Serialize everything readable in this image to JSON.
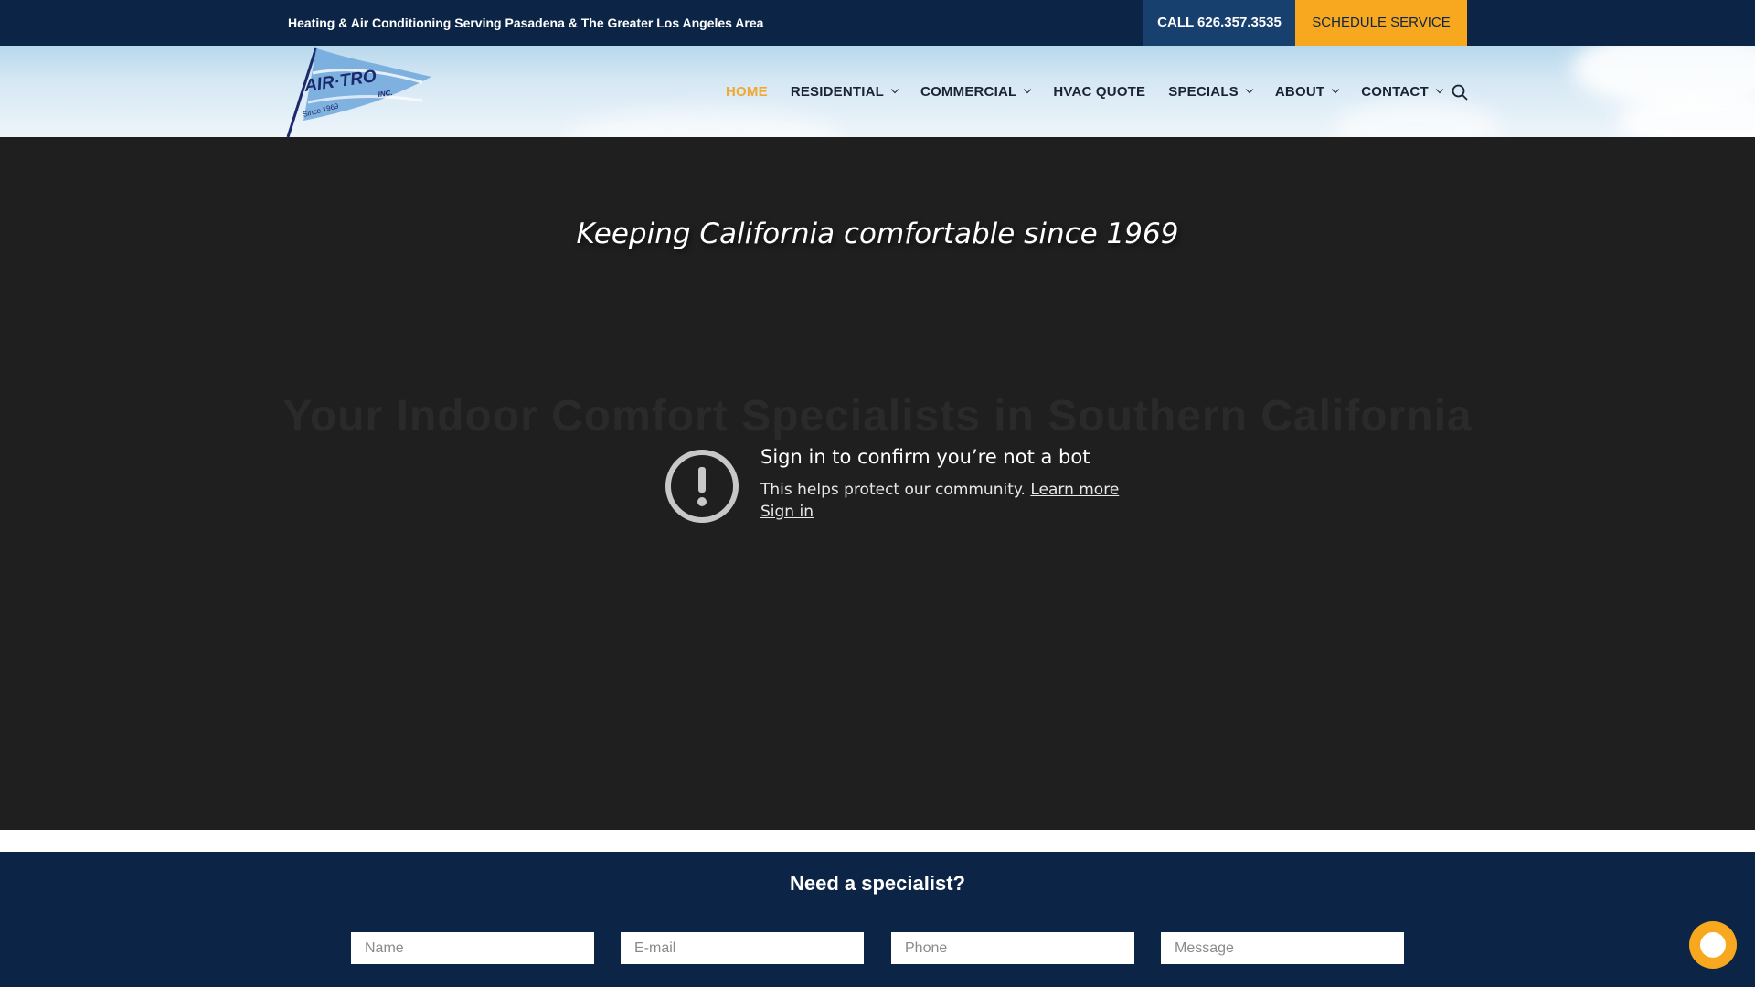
{
  "topbar": {
    "tagline": "Heating & Air Conditioning Serving Pasadena & The Greater Los Angeles Area",
    "call_label": "CALL 626.357.3535",
    "schedule_label": "SCHEDULE SERVICE"
  },
  "logo": {
    "text": "AIR·TRO",
    "suffix": "INC.",
    "since": "Since 1969"
  },
  "nav": {
    "items": [
      {
        "label": "HOME",
        "active": true,
        "dropdown": false
      },
      {
        "label": "RESIDENTIAL",
        "active": false,
        "dropdown": true
      },
      {
        "label": "COMMERCIAL",
        "active": false,
        "dropdown": true
      },
      {
        "label": "HVAC QUOTE",
        "active": false,
        "dropdown": false
      },
      {
        "label": "SPECIALS",
        "active": false,
        "dropdown": true
      },
      {
        "label": "ABOUT",
        "active": false,
        "dropdown": true
      },
      {
        "label": "CONTACT",
        "active": false,
        "dropdown": true
      }
    ],
    "search_icon": "search-icon"
  },
  "video": {
    "hero_title": "Keeping California comfortable since 1969",
    "ghost_text": "Your Indoor Comfort Specialists in Southern California",
    "bot_title": "Sign in to confirm you’re not a bot",
    "bot_sub": "This helps protect our community.",
    "learn_more": "Learn more",
    "sign_in": "Sign in"
  },
  "specialist": {
    "title": "Need a specialist?",
    "fields": [
      {
        "placeholder": "Name"
      },
      {
        "placeholder": "E-mail"
      },
      {
        "placeholder": "Phone"
      },
      {
        "placeholder": "Message"
      }
    ]
  },
  "colors": {
    "navy": "#0c2546",
    "call_blue": "#17406f",
    "accent_orange": "#f8a81e",
    "video_bg": "#1f1f1f"
  }
}
